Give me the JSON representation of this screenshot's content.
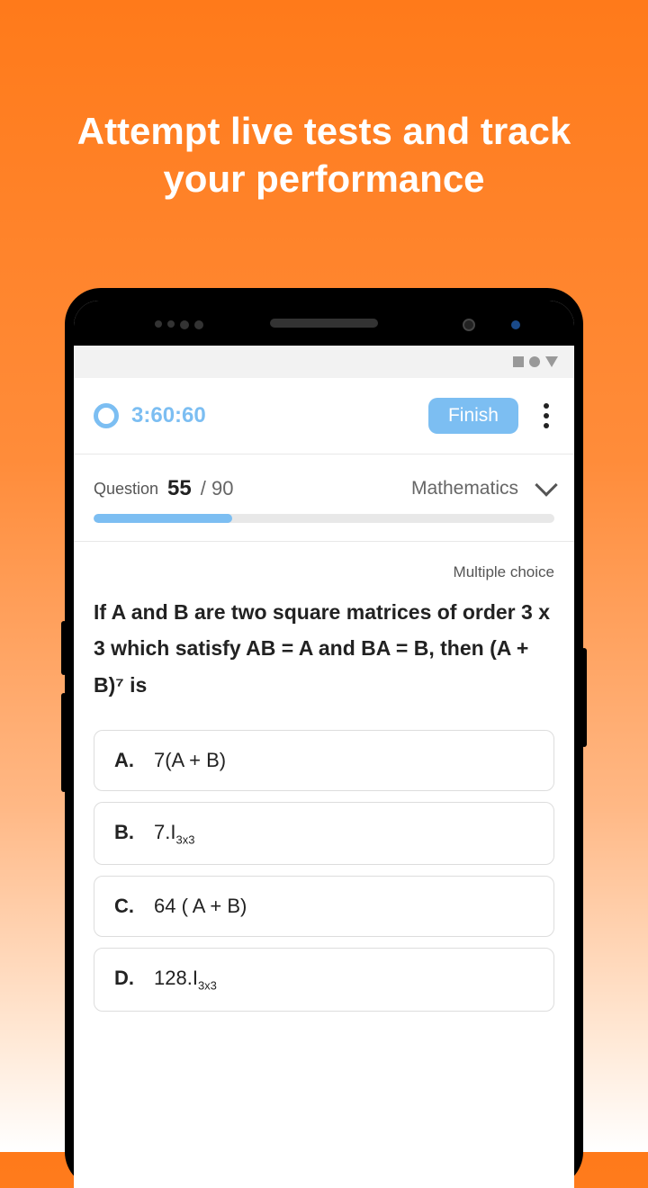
{
  "headline": "Attempt live tests and track your performance",
  "timer": "3:60:60",
  "finish_label": "Finish",
  "question": {
    "label": "Question",
    "current": "55",
    "separator": "/",
    "total": "90",
    "subject": "Mathematics",
    "type": "Multiple choice",
    "text": "If A and B are two square matrices of order 3 x 3 which satisfy AB = A and BA = B, then (A + B)⁷ is",
    "progress_percent": 30
  },
  "options": [
    {
      "letter": "A.",
      "text": "7(A + B)"
    },
    {
      "letter": "B.",
      "text_html": "7.I<span class='sub'>3x3</span>"
    },
    {
      "letter": "C.",
      "text": "64 ( A + B)"
    },
    {
      "letter": "D.",
      "text_html": "128.I<span class='sub'>3x3</span>"
    }
  ]
}
